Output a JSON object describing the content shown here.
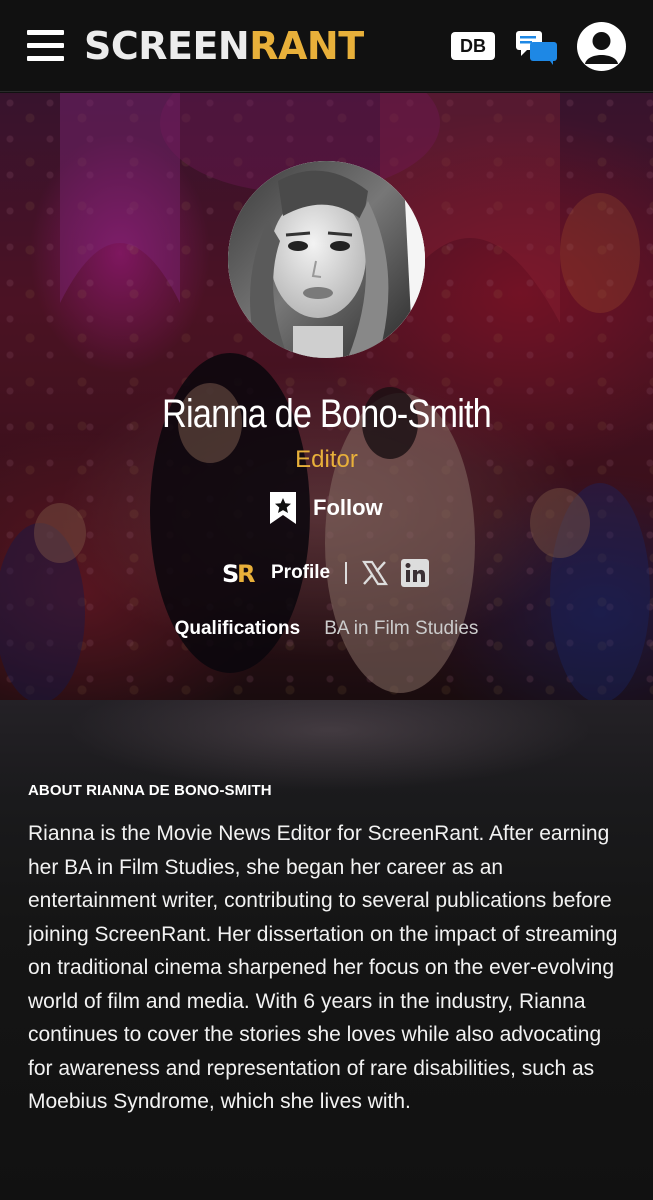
{
  "header": {
    "logo_screen": "SCREEN",
    "logo_rant": "RANT",
    "db_label": "DB"
  },
  "author": {
    "name": "Rianna de Bono-Smith",
    "role": "Editor",
    "follow_label": "Follow",
    "profile_label": "Profile",
    "qualifications_label": "Qualifications",
    "qualifications_value": "BA in Film Studies"
  },
  "about": {
    "heading": "ABOUT RIANNA DE BONO-SMITH",
    "bio": "Rianna is the Movie News Editor for ScreenRant. After earning her BA in Film Studies, she began her career as an entertainment writer, contributing to several publications before joining ScreenRant. Her dissertation on the impact of streaming on traditional cinema sharpened her focus on the ever-evolving world of film and media. With 6 years in the industry, Rianna continues to cover the stories she loves while also advocating for awareness and representation of rare disabilities, such as Moebius Syndrome, which she lives with."
  },
  "colors": {
    "brand_accent": "#e8b03a",
    "header_bg": "#111111",
    "chat_blue": "#1e88e5"
  },
  "icons": [
    "menu-icon",
    "chat-icon",
    "account-icon",
    "bookmark-star-icon",
    "screenrant-sr-icon",
    "x-icon",
    "linkedin-icon"
  ]
}
